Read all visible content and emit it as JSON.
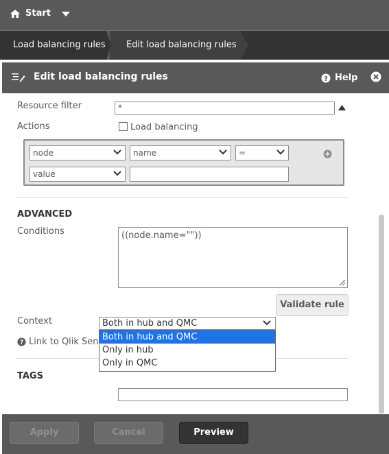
{
  "nav": {
    "home_label": "Start",
    "breadcrumbs": [
      {
        "label": "Load balancing rules"
      },
      {
        "label": "Edit load balancing rules"
      }
    ]
  },
  "panel": {
    "title": "Edit load balancing rules",
    "help_label": "Help"
  },
  "form": {
    "resource_filter_label": "Resource filter",
    "resource_filter_value": "*",
    "actions_label": "Actions",
    "load_balancing_label": "Load balancing",
    "load_balancing_checked": false,
    "row1": {
      "field": "node",
      "property": "name",
      "operator": "="
    },
    "row2": {
      "field": "value",
      "value": ""
    }
  },
  "advanced": {
    "title": "ADVANCED",
    "conditions_label": "Conditions",
    "conditions_value": "((node.name=\"\"))",
    "validate_label": "Validate rule",
    "context_label": "Context",
    "context_selected": "Both in hub and QMC",
    "context_options": [
      "Both in hub and QMC",
      "Only in hub",
      "Only in QMC"
    ],
    "link_label": "Link to Qlik Sena"
  },
  "tags": {
    "title": "TAGS",
    "value": ""
  },
  "footer": {
    "apply_label": "Apply",
    "cancel_label": "Cancel",
    "preview_label": "Preview"
  },
  "colors": {
    "topbar": "#595959",
    "crumbs": "#333333",
    "selection": "#1e73e8"
  }
}
